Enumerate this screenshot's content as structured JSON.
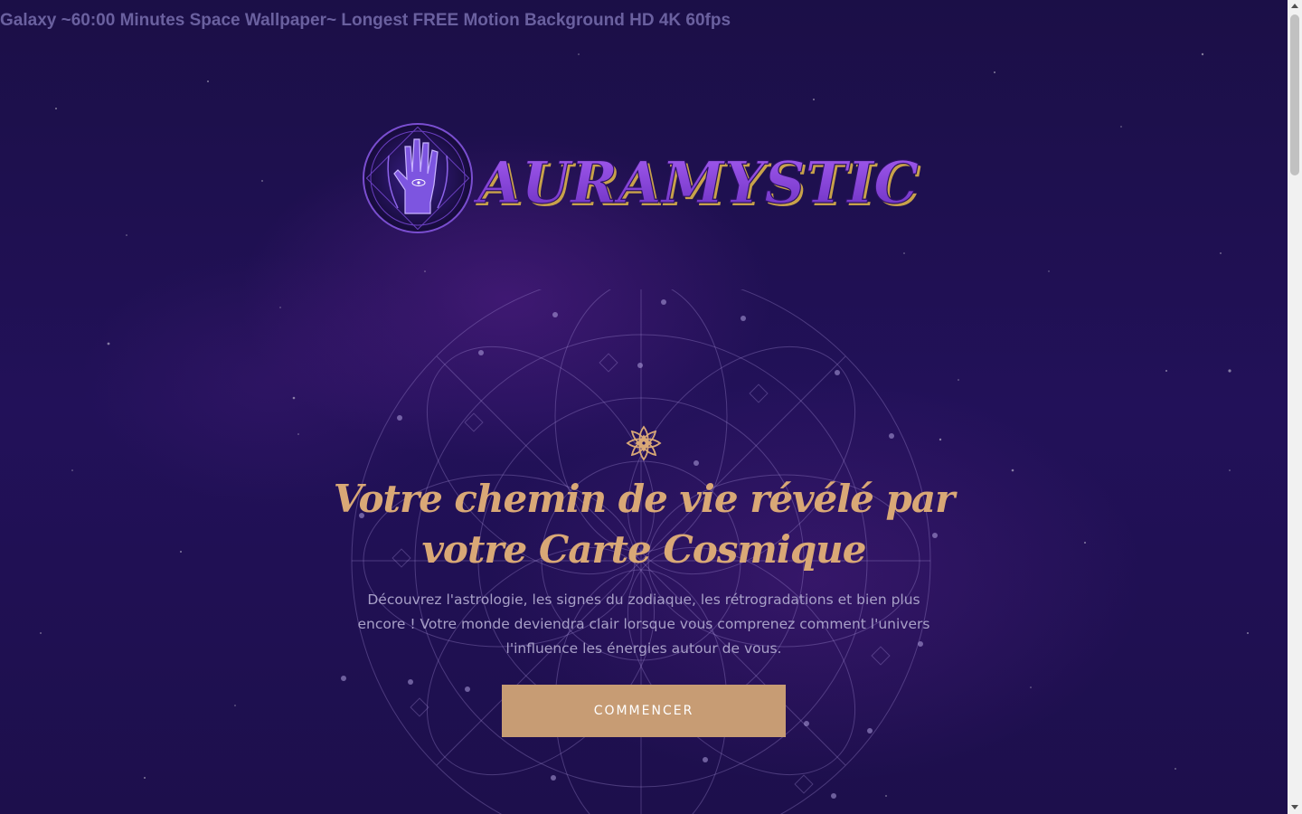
{
  "video": {
    "title": "Galaxy ~60:00 Minutes Space Wallpaper~ Longest FREE Motion Background HD 4K 60fps"
  },
  "logo": {
    "text": "AURAMYSTIC",
    "icon": "palm-hand-icon"
  },
  "hero": {
    "icon": "lotus-icon",
    "title": "Votre chemin de vie révélé par votre Carte Cosmique",
    "description": "Découvrez l'astrologie, les signes du zodiaque, les rétrogradations et bien plus encore ! Votre monde deviendra clair lorsque vous comprenez comment l'univers l'influence les énergies autour de vous.",
    "cta_label": "COMMENCER"
  },
  "colors": {
    "background": "#1c0f48",
    "accent_gold": "#d9a876",
    "button": "#c79c74",
    "logo_purple": "#7a3fd0",
    "body_text": "#a8a0c8"
  }
}
